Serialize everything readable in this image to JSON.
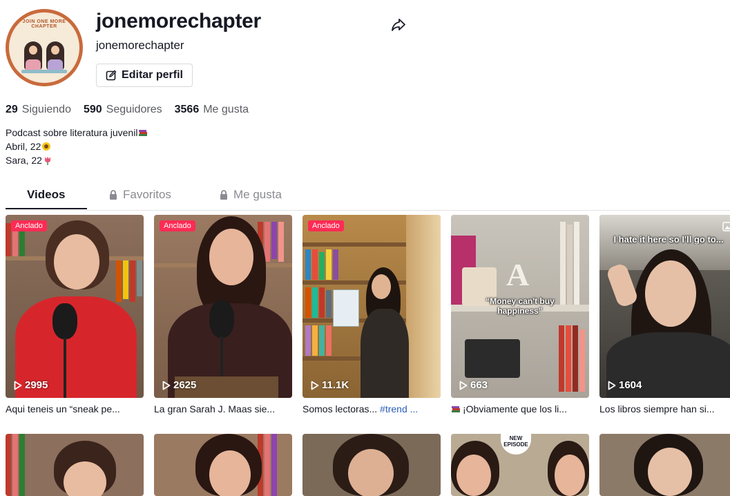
{
  "profile": {
    "title": "jonemorechapter",
    "username": "jonemorechapter",
    "edit_label": "Editar perfil",
    "avatar_text": "JOIN ONE MORE CHAPTER"
  },
  "stats": [
    {
      "value": "29",
      "label": "Siguiendo"
    },
    {
      "value": "590",
      "label": "Seguidores"
    },
    {
      "value": "3566",
      "label": "Me gusta"
    }
  ],
  "bio": {
    "line1": "Podcast sobre literatura juvenil",
    "line2": "Abril, 22",
    "line3": "Sara, 22"
  },
  "tabs": [
    {
      "label": "Videos",
      "active": true
    },
    {
      "label": "Favoritos",
      "locked": true
    },
    {
      "label": "Me gusta",
      "locked": true
    }
  ],
  "videos": [
    {
      "pinned": "Anclado",
      "views": "2995",
      "caption": "Aqui teneis un “sneak pe..."
    },
    {
      "pinned": "Anclado",
      "views": "2625",
      "caption": "La gran Sarah J. Maas sie..."
    },
    {
      "pinned": "Anclado",
      "views": "11.1K",
      "caption_text": "Somos lectoras... ",
      "caption_tag": "#trend ..."
    },
    {
      "views": "663",
      "caption": "¡Obviamente que los li...",
      "overlay": "“Money can't buy happiness”"
    },
    {
      "views": "1604",
      "caption": "Los libros siempre han si...",
      "overlay": "I hate it here so I'll go to..."
    }
  ],
  "row2": {
    "badge": "NEW EPISODE"
  },
  "colors": {
    "accent": "#fe2c55",
    "hashtag": "#2b5db9",
    "text": "#161823"
  }
}
